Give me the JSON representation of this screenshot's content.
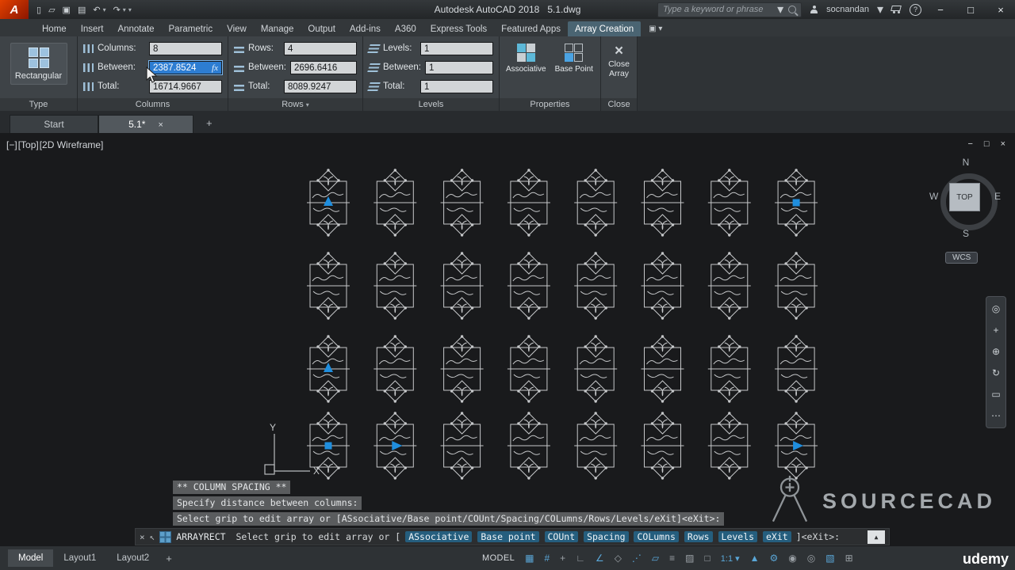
{
  "colors": {
    "accent": "#2d7dd2",
    "grip": "#1f8ede",
    "contextual_tab": "#4a6472",
    "command_chip": "#255e7e",
    "status_active": "#5aa7d8",
    "field_selection": "#2d7dd2"
  },
  "icons": {
    "logo": "A",
    "new": "▯",
    "open": "▱",
    "save": "▣",
    "plot": "▤",
    "undo": "↶",
    "redo": "↷",
    "dropdown": "▾",
    "panel_toggle": "▣",
    "minimize": "−",
    "maximize": "□",
    "close": "×",
    "tab_close": "×",
    "plus": "+",
    "fx": "fx",
    "close_array": "×",
    "cmd_close": "×",
    "cmd_pointer": "↖",
    "history_toggle": "▲",
    "vp_minimize": "−",
    "vp_maximize": "□",
    "vp_close": "×"
  },
  "title_bar": {
    "app_title": "Autodesk AutoCAD 2018   5.1.dwg",
    "search_placeholder": "Type a keyword or phrase",
    "user": "socnandan"
  },
  "ribbon": {
    "tabs": [
      "Home",
      "Insert",
      "Annotate",
      "Parametric",
      "View",
      "Manage",
      "Output",
      "Add-ins",
      "A360",
      "Express Tools",
      "Featured Apps",
      "Array Creation"
    ],
    "active_tab": "Array Creation",
    "type_panel": {
      "label": "Type",
      "button_label": "Rectangular"
    },
    "columns_panel": {
      "label": "Columns",
      "fields": [
        {
          "label": "Columns:",
          "value": "8"
        },
        {
          "label": "Between:",
          "value": "2387.8524"
        },
        {
          "label": "Total:",
          "value": "16714.9667"
        }
      ]
    },
    "rows_panel": {
      "label": "Rows",
      "fields": [
        {
          "label": "Rows:",
          "value": "4"
        },
        {
          "label": "Between:",
          "value": "2696.6416"
        },
        {
          "label": "Total:",
          "value": "8089.9247"
        }
      ]
    },
    "levels_panel": {
      "label": "Levels",
      "fields": [
        {
          "label": "Levels:",
          "value": "1"
        },
        {
          "label": "Between:",
          "value": "1"
        },
        {
          "label": "Total:",
          "value": "1"
        }
      ]
    },
    "properties_panel": {
      "label": "Properties",
      "associative_label": "Associative",
      "base_point_label": "Base Point"
    },
    "close_panel": {
      "label": "Close",
      "button_label": "Close Array"
    }
  },
  "file_tabs": {
    "tabs": [
      "Start",
      "5.1*"
    ],
    "active": "5.1*"
  },
  "viewport": {
    "controls": [
      "[−]",
      "[Top]",
      "[2D Wireframe]"
    ],
    "viewcube": {
      "n": "N",
      "w": "W",
      "e": "E",
      "s": "S",
      "top": "TOP"
    },
    "wcs_label": "WCS"
  },
  "nav_bar": {
    "icons": [
      {
        "name": "full-navigation-wheel",
        "glyph": "◎"
      },
      {
        "name": "pan",
        "glyph": "+"
      },
      {
        "name": "zoom",
        "glyph": "⊕"
      },
      {
        "name": "orbit",
        "glyph": "↻"
      },
      {
        "name": "show-motion",
        "glyph": "▭"
      },
      {
        "name": "more",
        "glyph": "⋯"
      }
    ]
  },
  "array": {
    "rows": 4,
    "columns": 8,
    "grips": [
      {
        "row": 0,
        "col": 0,
        "type": "arrow-up"
      },
      {
        "row": 0,
        "col": 7,
        "type": "square"
      },
      {
        "row": 2,
        "col": 0,
        "type": "arrow-up"
      },
      {
        "row": 3,
        "col": 0,
        "type": "square"
      },
      {
        "row": 3,
        "col": 1,
        "type": "arrow-right"
      },
      {
        "row": 3,
        "col": 7,
        "type": "arrow-right"
      }
    ],
    "axis_labels": {
      "x": "X",
      "y": "Y"
    }
  },
  "command_line": {
    "history": [
      "** COLUMN SPACING **",
      "Specify distance between columns:",
      "Select grip to edit array or [ASsociative/Base point/COUnt/Spacing/COLumns/Rows/Levels/eXit]<eXit>:"
    ],
    "command": "ARRAYRECT",
    "prompt_prefix": " Select grip to edit array or [",
    "options": [
      "ASsociative",
      "Base point",
      "COUnt",
      "Spacing",
      "COLumns",
      "Rows",
      "Levels",
      "eXit"
    ],
    "prompt_suffix": "]<eXit>:"
  },
  "layout_tabs": {
    "tabs": [
      "Model",
      "Layout1",
      "Layout2"
    ],
    "active": "Model"
  },
  "status_bar": {
    "model_label": "MODEL",
    "icons": [
      {
        "name": "grid-display",
        "glyph": "▦",
        "active": true
      },
      {
        "name": "snap-mode",
        "glyph": "#",
        "active": true
      },
      {
        "name": "infer-constraints",
        "glyph": "+",
        "active": false
      },
      {
        "name": "ortho-mode",
        "glyph": "∟",
        "active": false
      },
      {
        "name": "polar-tracking",
        "glyph": "∠",
        "active": true
      },
      {
        "name": "isometric-drafting",
        "glyph": "◇",
        "active": false
      },
      {
        "name": "object-snap-tracking",
        "glyph": "⋰",
        "active": true
      },
      {
        "name": "object-snap",
        "glyph": "▱",
        "active": true
      },
      {
        "name": "lineweight",
        "glyph": "≡",
        "active": false
      },
      {
        "name": "transparency",
        "glyph": "▨",
        "active": false
      },
      {
        "name": "selection-cycling",
        "glyph": "□",
        "active": false
      },
      {
        "name": "annotation-scale",
        "glyph": "1:1 ▾",
        "active": true
      },
      {
        "name": "annotation-visibility",
        "glyph": "▲",
        "active": true
      },
      {
        "name": "workspace",
        "glyph": "⚙",
        "active": true
      },
      {
        "name": "annotation-monitor",
        "glyph": "◉",
        "active": false
      },
      {
        "name": "isolate-objects",
        "glyph": "◎",
        "active": false
      },
      {
        "name": "graphics-performance",
        "glyph": "▧",
        "active": true
      },
      {
        "name": "clean-screen",
        "glyph": "⊞",
        "active": false
      }
    ]
  },
  "watermark": {
    "logo_text": "SOURCECAD",
    "brand": "udemy"
  }
}
